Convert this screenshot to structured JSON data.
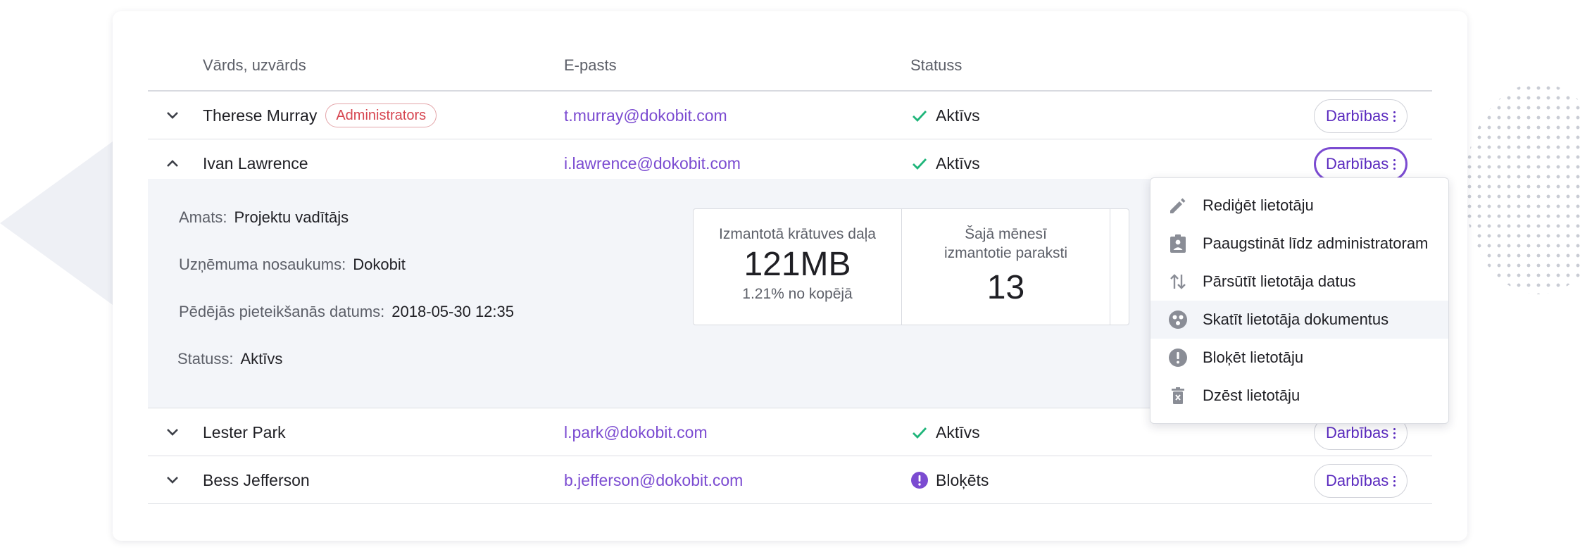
{
  "table": {
    "headers": {
      "name": "Vārds, uzvārds",
      "email": "E-pasts",
      "status": "Statuss"
    },
    "action_label": "Darbības",
    "rows": [
      {
        "name": "Therese Murray",
        "badge": "Administrators",
        "email": "t.murray@dokobit.com",
        "status": "Aktīvs",
        "status_icon": "check-icon",
        "expanded": false
      },
      {
        "name": "Ivan Lawrence",
        "email": "i.lawrence@dokobit.com",
        "status": "Aktīvs",
        "status_icon": "check-icon",
        "expanded": true
      },
      {
        "name": "Lester Park",
        "email": "l.park@dokobit.com",
        "status": "Aktīvs",
        "status_icon": "check-icon",
        "expanded": false
      },
      {
        "name": "Bess Jefferson",
        "email": "b.jefferson@dokobit.com",
        "status": "Bloķēts",
        "status_icon": "blocked-icon",
        "expanded": false
      }
    ]
  },
  "details": {
    "position_label": "Amats:",
    "position_value": "Projektu vadītājs",
    "company_label": "Uzņēmuma nosaukums:",
    "company_value": "Dokobit",
    "last_login_label": "Pēdējās pieteikšanās datums:",
    "last_login_value": "2018-05-30 12:35",
    "status_label": "Statuss:",
    "status_value": "Aktīvs",
    "stats": [
      {
        "label": "Izmantotā krātuves daļa",
        "value": "121MB",
        "sub": "1.21% no kopējā"
      },
      {
        "label": "Šajā mēnesī izmantotie paraksti",
        "value": "13"
      }
    ]
  },
  "menu": {
    "items": [
      {
        "label": "Rediģēt lietotāju",
        "icon": "pencil-icon"
      },
      {
        "label": "Paaugstināt līdz administratoram",
        "icon": "admin-badge-icon"
      },
      {
        "label": "Pārsūtīt lietotāja datus",
        "icon": "transfer-icon"
      },
      {
        "label": "Skatīt lietotāja dokumentus",
        "icon": "documents-icon",
        "highlighted": true
      },
      {
        "label": "Bloķēt lietotāju",
        "icon": "block-icon"
      },
      {
        "label": "Dzēst lietotāju",
        "icon": "trash-icon"
      }
    ]
  },
  "colors": {
    "accent": "#7b4bd1",
    "success": "#1fb57a",
    "danger": "#d64550",
    "muted_icon": "#8a8d96"
  }
}
